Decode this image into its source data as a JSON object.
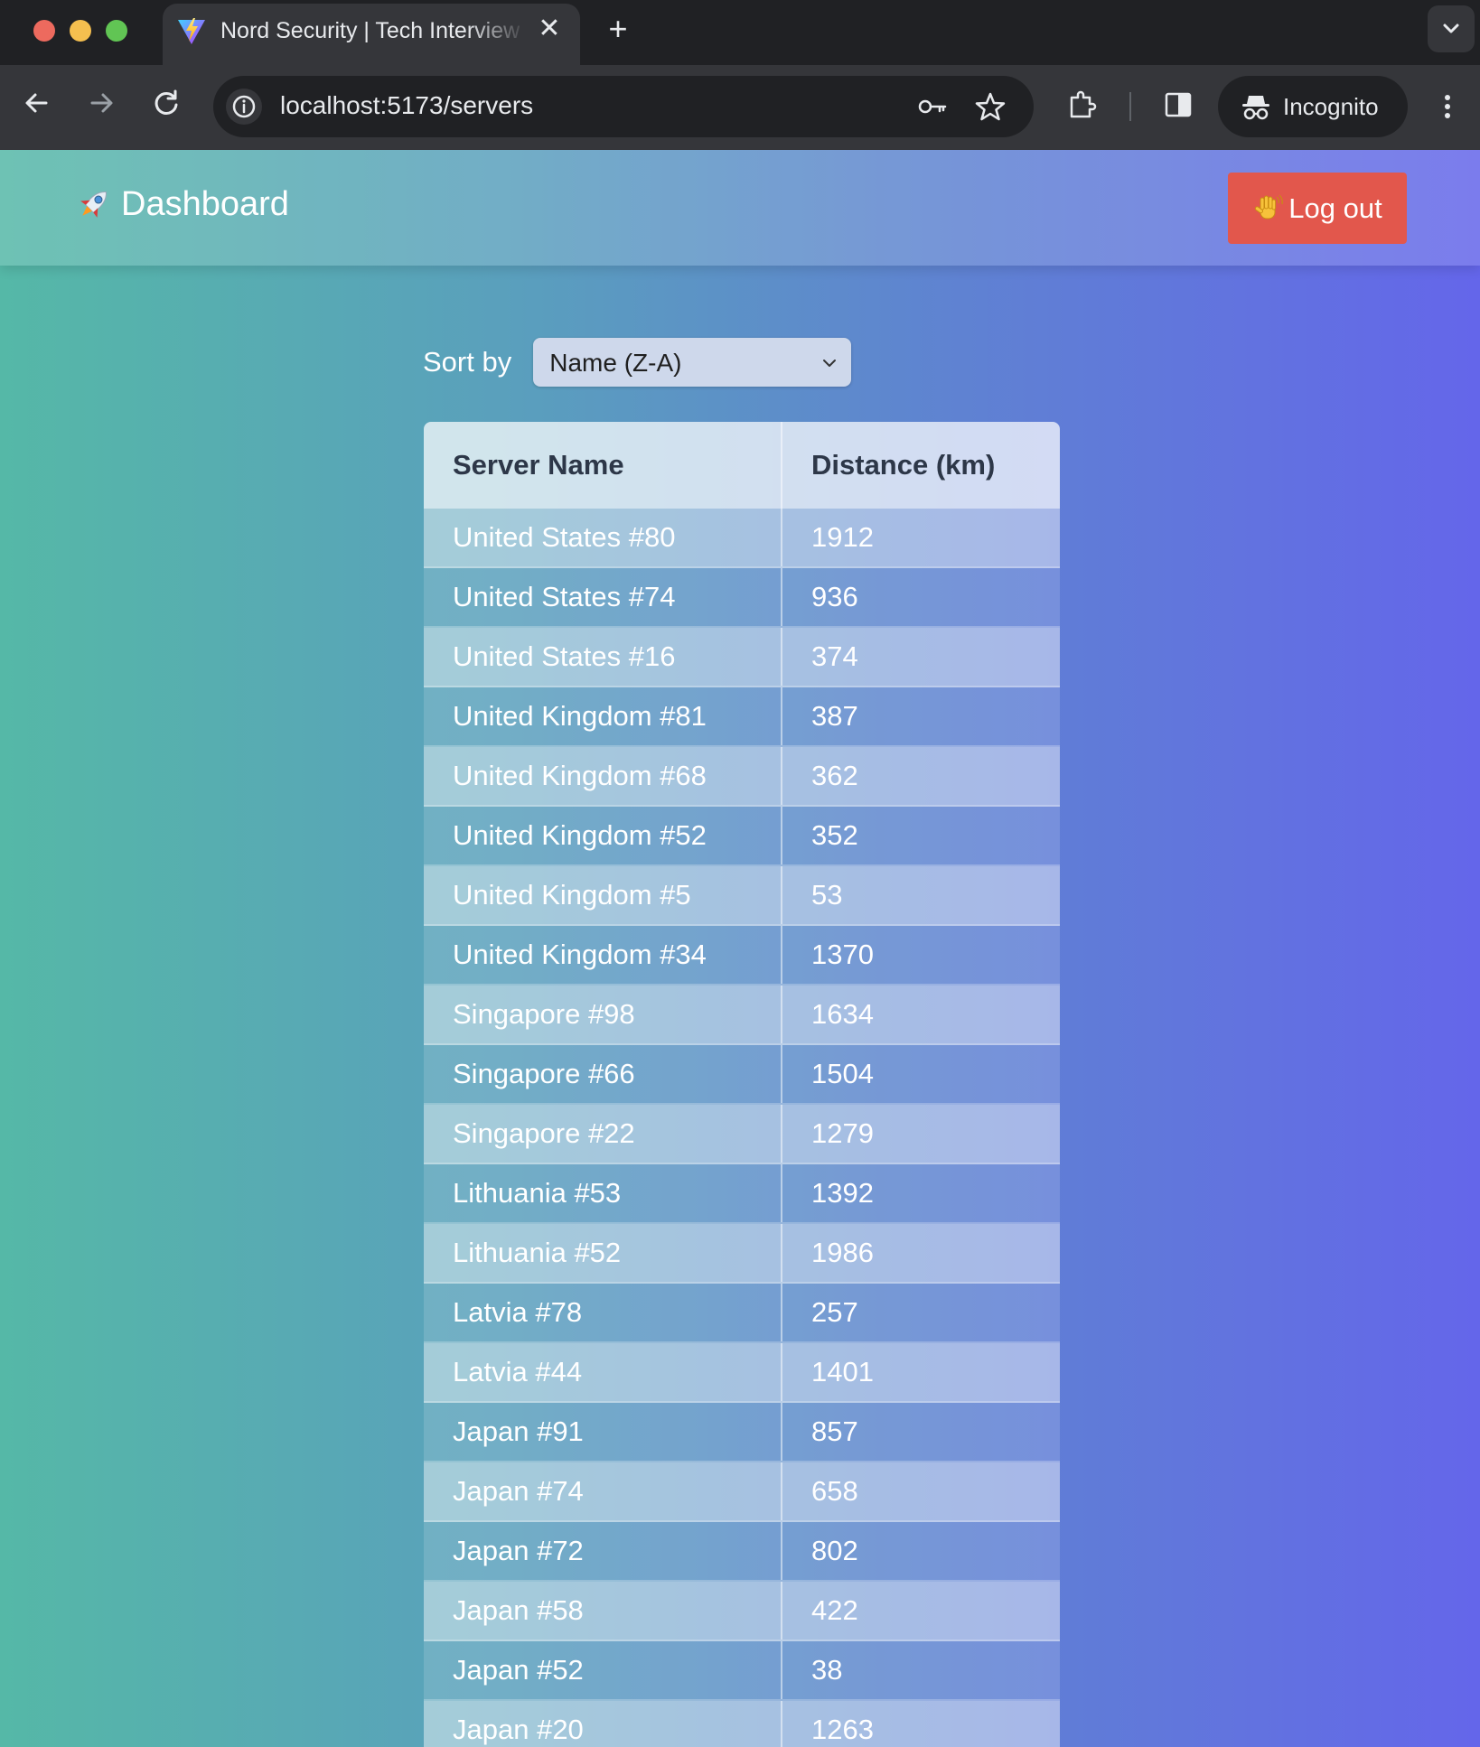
{
  "browser": {
    "tab_title": "Nord Security | Tech Interview",
    "tab_close": "✕",
    "new_tab": "+",
    "url": "localhost:5173/servers",
    "profile_label": "Incognito"
  },
  "navbar": {
    "brand_label": "Dashboard",
    "logout_label": "Log out"
  },
  "sort": {
    "label": "Sort by",
    "selected": "Name (Z-A)"
  },
  "table": {
    "headers": [
      "Server Name",
      "Distance (km)"
    ],
    "rows": [
      {
        "name": "United States #80",
        "distance": "1912"
      },
      {
        "name": "United States #74",
        "distance": "936"
      },
      {
        "name": "United States #16",
        "distance": "374"
      },
      {
        "name": "United Kingdom #81",
        "distance": "387"
      },
      {
        "name": "United Kingdom #68",
        "distance": "362"
      },
      {
        "name": "United Kingdom #52",
        "distance": "352"
      },
      {
        "name": "United Kingdom #5",
        "distance": "53"
      },
      {
        "name": "United Kingdom #34",
        "distance": "1370"
      },
      {
        "name": "Singapore #98",
        "distance": "1634"
      },
      {
        "name": "Singapore #66",
        "distance": "1504"
      },
      {
        "name": "Singapore #22",
        "distance": "1279"
      },
      {
        "name": "Lithuania #53",
        "distance": "1392"
      },
      {
        "name": "Lithuania #52",
        "distance": "1986"
      },
      {
        "name": "Latvia #78",
        "distance": "257"
      },
      {
        "name": "Latvia #44",
        "distance": "1401"
      },
      {
        "name": "Japan #91",
        "distance": "857"
      },
      {
        "name": "Japan #74",
        "distance": "658"
      },
      {
        "name": "Japan #72",
        "distance": "802"
      },
      {
        "name": "Japan #58",
        "distance": "422"
      },
      {
        "name": "Japan #52",
        "distance": "38"
      },
      {
        "name": "Japan #20",
        "distance": "1263"
      }
    ]
  },
  "colors": {
    "logout_bg": "#e2574c",
    "gradient_start": "#55b8a7",
    "gradient_end": "#6466ea"
  }
}
